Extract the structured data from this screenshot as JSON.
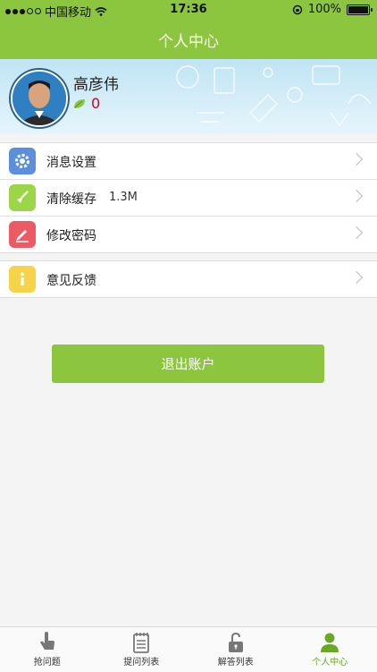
{
  "status_bar": {
    "carrier": "中国移动",
    "time": "17:36",
    "battery": "100%"
  },
  "nav": {
    "title": "个人中心"
  },
  "profile": {
    "name": "高彦伟",
    "score": "0"
  },
  "menu_group_1": [
    {
      "label": "消息设置",
      "icon": "gear-icon",
      "color": "#5b8fdc"
    },
    {
      "label": "清除缓存",
      "extra": "1.3M",
      "icon": "broom-icon",
      "color": "#9bd548"
    },
    {
      "label": "修改密码",
      "icon": "pencil-icon",
      "color": "#ec5a63"
    }
  ],
  "menu_group_2": [
    {
      "label": "意见反馈",
      "icon": "info-icon",
      "color": "#f7d34a"
    }
  ],
  "logout_label": "退出账户",
  "tabs": [
    {
      "label": "抢问题",
      "icon": "hand-pointer-icon",
      "active": false
    },
    {
      "label": "提问列表",
      "icon": "notepad-icon",
      "active": false
    },
    {
      "label": "解答列表",
      "icon": "unlock-icon",
      "active": false
    },
    {
      "label": "个人中心",
      "icon": "person-icon",
      "active": true
    }
  ],
  "colors": {
    "accent": "#8cc63f",
    "score": "#d0021b"
  }
}
